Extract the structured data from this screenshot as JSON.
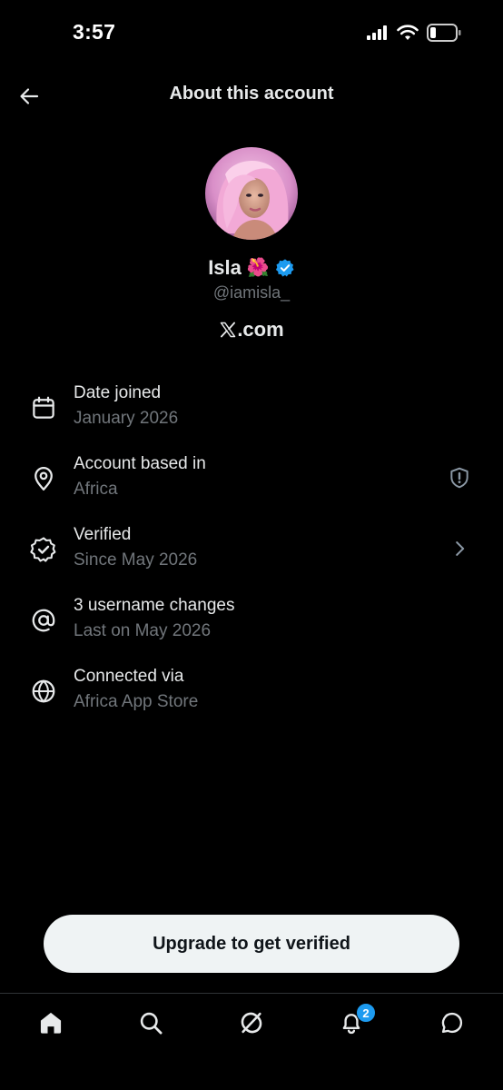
{
  "status_bar": {
    "time": "3:57"
  },
  "header": {
    "title": "About this account",
    "back_icon": "arrow-left-icon"
  },
  "profile": {
    "display_name": "Isla",
    "emoji": "🌺",
    "verified": true,
    "handle": "@iamisla_",
    "site": ".com",
    "site_logo": "x-logo-icon"
  },
  "details": [
    {
      "icon": "calendar-icon",
      "title": "Date joined",
      "subtitle": "January 2026"
    },
    {
      "icon": "location-pin-icon",
      "title": "Account based in",
      "subtitle": "Africa",
      "trailing": "shield-alert-icon"
    },
    {
      "icon": "verified-badge-icon",
      "title": "Verified",
      "subtitle": "Since May 2026",
      "trailing": "chevron-right-icon"
    },
    {
      "icon": "at-sign-icon",
      "title": "3 username changes",
      "subtitle": "Last on May 2026"
    },
    {
      "icon": "globe-icon",
      "title": "Connected via",
      "subtitle": "Africa App Store"
    }
  ],
  "upgrade": {
    "label": "Upgrade to get verified"
  },
  "bottom_nav": {
    "items": [
      "home-icon",
      "search-icon",
      "grok-icon",
      "notifications-icon",
      "messages-icon"
    ],
    "notification_count": "2"
  },
  "colors": {
    "background": "#000000",
    "text": "#e7e9ea",
    "secondary": "#71767b",
    "accent": "#1d9bf0"
  }
}
